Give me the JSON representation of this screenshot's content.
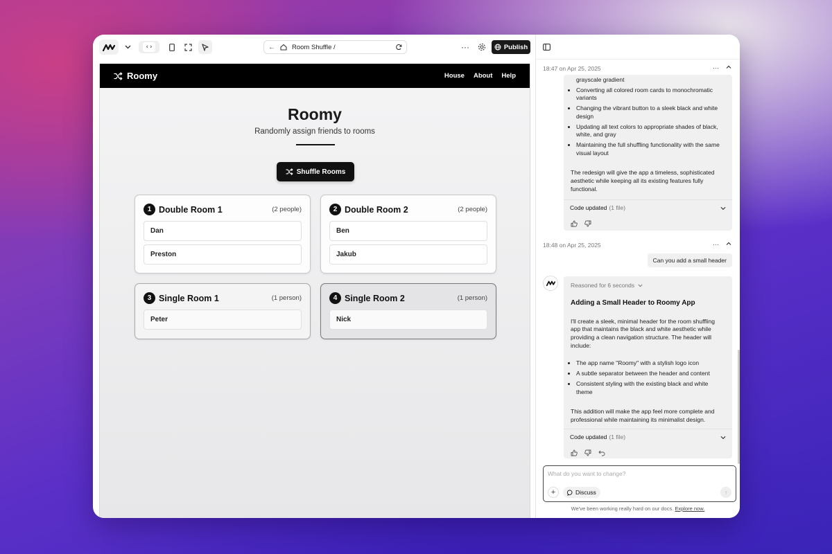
{
  "toolbar": {
    "url": "Room Shuffle /",
    "publish_label": "Publish",
    "more_label": "···"
  },
  "app": {
    "brand": "Roomy",
    "nav": [
      "House",
      "About",
      "Help"
    ],
    "title": "Roomy",
    "subtitle": "Randomly assign friends to rooms",
    "shuffle_label": "Shuffle Rooms",
    "rooms": [
      {
        "num": "1",
        "name": "Double Room 1",
        "count": "(2 people)",
        "people": [
          "Dan",
          "Preston"
        ]
      },
      {
        "num": "2",
        "name": "Double Room 2",
        "count": "(2 people)",
        "people": [
          "Ben",
          "Jakub"
        ]
      },
      {
        "num": "3",
        "name": "Single Room 1",
        "count": "(1 person)",
        "people": [
          "Peter"
        ]
      },
      {
        "num": "4",
        "name": "Single Room 2",
        "count": "(1 person)",
        "people": [
          "Nick"
        ]
      }
    ]
  },
  "chat": {
    "msg1": {
      "time": "18:47 on Apr 25, 2025",
      "bullets": [
        "grayscale gradient",
        "Converting all colored room cards to monochromatic variants",
        "Changing the vibrant button to a sleek black and white design",
        "Updating all text colors to appropriate shades of black, white, and gray",
        "Maintaining the full shuffling functionality with the same visual layout"
      ],
      "para": "The redesign will give the app a timeless, sophisticated aesthetic while keeping all its existing features fully functional.",
      "code_updated": "Code updated",
      "files": "(1 file)"
    },
    "msg2": {
      "time": "18:48 on Apr 25, 2025",
      "user_text": "Can you add a small header",
      "reasoned": "Reasoned for 6 seconds",
      "heading": "Adding a Small Header to Roomy App",
      "intro": "I'll create a sleek, minimal header for the room shuffling app that maintains the black and white aesthetic while providing a clean navigation structure. The header will include:",
      "bullets": [
        "The app name \"Roomy\" with a stylish logo icon",
        "A subtle separator between the header and content",
        "Consistent styling with the existing black and white theme"
      ],
      "outro": "This addition will make the app feel more complete and professional while maintaining its minimalist design.",
      "code_updated": "Code updated",
      "files": "(1 file)"
    },
    "composer": {
      "placeholder": "What do you want to change?",
      "discuss_label": "Discuss"
    },
    "footnote_text": "We've been working really hard on our docs.",
    "footnote_link": "Explore now."
  }
}
